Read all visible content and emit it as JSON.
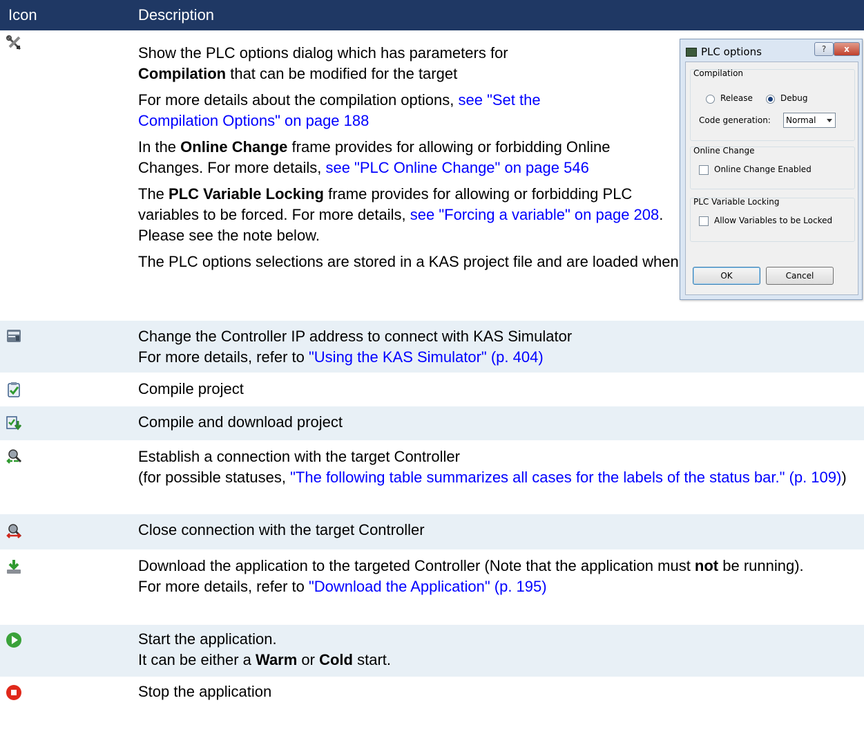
{
  "header": {
    "icon": "Icon",
    "description": "Description"
  },
  "row1": {
    "icon": "tools-icon",
    "p1_a": "Show the PLC options dialog which has parameters for",
    "p1_b": "Compilation",
    "p1_c": " that can be modified for the target",
    "p2_a": "For more details about the compilation options, ",
    "p2_link": "see \"Set the Compilation Options\" on page 188",
    "p3_a": "In the ",
    "p3_b": "Online Change",
    "p3_c": " frame provides for allowing or forbidding Online Changes. For more details, ",
    "p3_link": "see \"PLC Online Change\" on page 546",
    "p4_a": "The ",
    "p4_b": "PLC Variable Locking",
    "p4_c": " frame provides for allowing or forbidding PLC variables to be forced. For more details, ",
    "p4_link": "see \"Forcing a variable\" on page 208",
    "p4_d": ". Please see the note below.",
    "p5": "The PLC options selections are stored in a KAS project file and are loaded when the project is opened."
  },
  "dialog": {
    "title": "PLC options",
    "help": "?",
    "close": "x",
    "compilation_legend": "Compilation",
    "release": "Release",
    "debug": "Debug",
    "selected_mode": "Debug",
    "code_generation_label": "Code generation:",
    "code_generation_value": "Normal",
    "online_change_legend": "Online Change",
    "online_change_enabled": "Online Change Enabled",
    "locking_legend": "PLC Variable Locking",
    "allow_locked": "Allow Variables to be Locked",
    "ok": "OK",
    "cancel": "Cancel"
  },
  "row2": {
    "icon": "simulator-icon",
    "line1": "Change the Controller IP address to connect with KAS Simulator",
    "line2_a": "For more details, refer to ",
    "line2_link": "\"Using the KAS Simulator\" (p. 404)"
  },
  "row3": {
    "icon": "compile-icon",
    "text": "Compile project"
  },
  "row4": {
    "icon": "compile-download-icon",
    "text": "Compile and download project"
  },
  "row5": {
    "icon": "connect-icon",
    "line1": "Establish a connection with the target Controller",
    "line2_a": "(for possible statuses, ",
    "line2_link": "\"The following table summarizes all cases for the labels of the status bar.\" (p. 109)",
    "line2_b": ")"
  },
  "row6": {
    "icon": "disconnect-icon",
    "text": "Close connection with the target Controller"
  },
  "row7": {
    "icon": "download-icon",
    "line1_a": "Download the application to the targeted Controller (Note that the application must ",
    "line1_b": "not",
    "line1_c": " be running).",
    "line2_a": "For more details, refer to ",
    "line2_link": "\"Download the Application\" (p. 195)"
  },
  "row8": {
    "icon": "start-icon",
    "line1": "Start the application.",
    "line2_a": "It can be either a ",
    "line2_b": "Warm",
    "line2_c": " or ",
    "line2_d": "Cold",
    "line2_e": " start."
  },
  "row9": {
    "icon": "stop-icon",
    "text": "Stop the application"
  },
  "colors": {
    "header_bg": "#1f3864",
    "alt_row_bg": "#e8f0f6",
    "link": "#0000ff"
  }
}
